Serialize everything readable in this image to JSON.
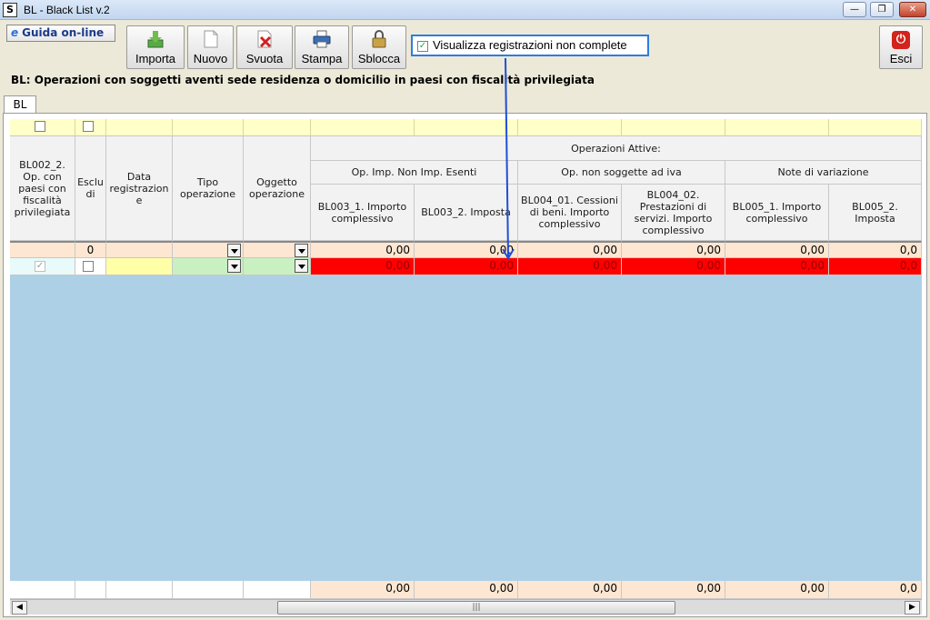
{
  "window": {
    "title": "BL - Black List v.2",
    "app_icon": "S",
    "controls": {
      "minimize": "—",
      "restore": "❐",
      "close": "✕"
    }
  },
  "toolbar": {
    "guida_label": "Guida on-line",
    "guida_icon": "e",
    "buttons": [
      {
        "label": "Importa",
        "icon": "import-icon"
      },
      {
        "label": "Nuovo",
        "icon": "new-document-icon"
      },
      {
        "label": "Svuota",
        "icon": "clear-x-icon"
      },
      {
        "label": "Stampa",
        "icon": "printer-icon"
      },
      {
        "label": "Sblocca",
        "icon": "padlock-icon"
      }
    ],
    "show_incomplete_label": "Visualizza registrazioni non complete",
    "show_incomplete_checked": true,
    "esci_label": "Esci"
  },
  "heading": "BL: Operazioni con soggetti aventi sede residenza o domicilio in paesi con fiscalità privilegiata",
  "tab": "BL",
  "grid": {
    "group_header": "Operazioni Attive:",
    "subgroups": [
      "Op. Imp. Non Imp. Esenti",
      "Op. non soggette ad iva",
      "Note di variazione"
    ],
    "columns": [
      "BL002_2. Op. con paesi con fiscalità privilegiata",
      "Esclu di",
      "Data registrazion e",
      "Tipo operazione",
      "Oggetto operazione",
      "BL003_1. Importo complessivo",
      "BL003_2. Imposta",
      "BL004_01. Cessioni di beni. Importo complessivo",
      "BL004_02. Prestazioni di servizi. Importo complessivo",
      "BL005_1. Importo complessivo",
      "BL005_2. Imposta"
    ],
    "summary_row": {
      "escludi": "0",
      "values": [
        "0,00",
        "0,00",
        "0,00",
        "0,00",
        "0,00",
        "0,0"
      ]
    },
    "data_row": {
      "values": [
        "0,00",
        "0,00",
        "0,00",
        "0,00",
        "0,00",
        "0,0"
      ]
    },
    "footer_totals": [
      "0,00",
      "0,00",
      "0,00",
      "0,00",
      "0,00",
      "0,0"
    ],
    "scroll_grip": "|||"
  },
  "colors": {
    "selection_border": "#2d7de0",
    "incomplete_row": "#ff0000",
    "grid_background": "#aed0e7",
    "filter_row": "#ffffc7",
    "total_row": "#fde7d2"
  }
}
